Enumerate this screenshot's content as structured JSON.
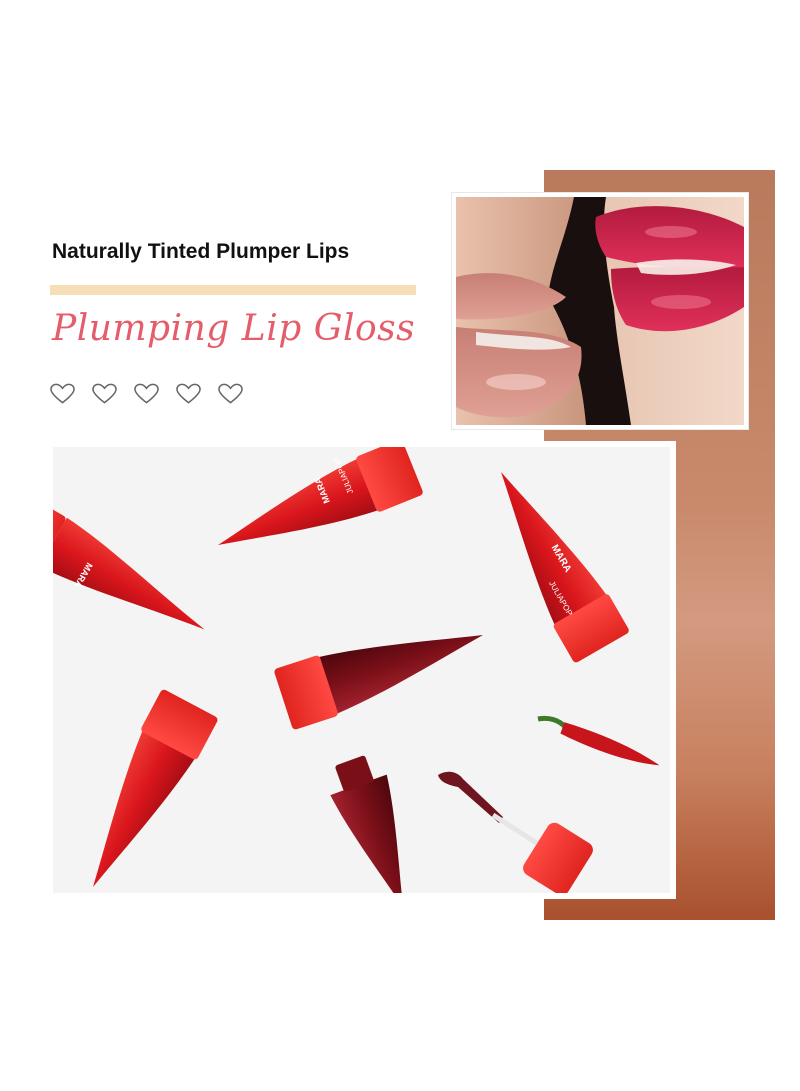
{
  "headline": "Naturally Tinted Plumper Lips",
  "subtitle": "Plumping Lip Gloss",
  "rating_icons": [
    "heart-outline-icon",
    "heart-outline-icon",
    "heart-outline-icon",
    "heart-outline-icon",
    "heart-outline-icon"
  ],
  "colors": {
    "accent_script": "#e55d6b",
    "rule": "#f6dfb6",
    "panel_brown": "#b9795c",
    "tube_red": "#d9161c",
    "tube_dark": "#7a0f18"
  },
  "product_labels": {
    "brand": "MARA",
    "line": "JULIAPOP"
  }
}
